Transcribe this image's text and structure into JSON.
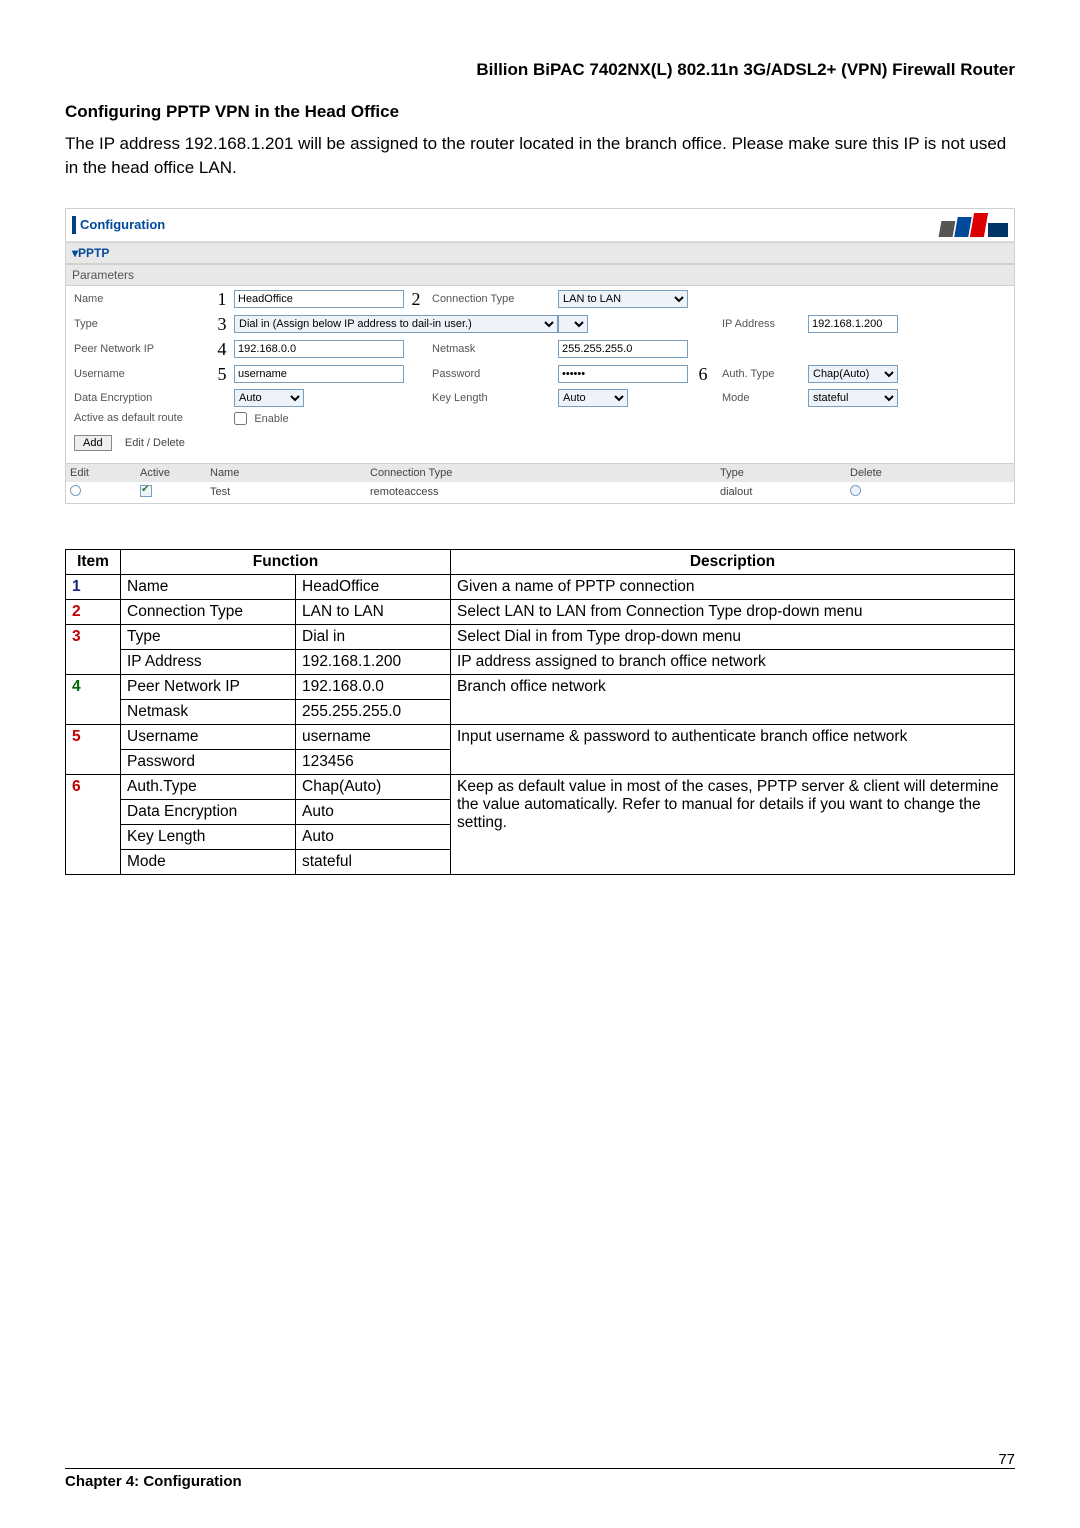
{
  "header": {
    "title": "Billion BiPAC 7402NX(L) 802.11n 3G/ADSL2+ (VPN) Firewall Router"
  },
  "section": {
    "heading": "Configuring PPTP VPN in the Head Office",
    "intro": "The IP address 192.168.1.201 will be assigned to the router located in the branch office. Please make sure this IP is not used in the head office LAN."
  },
  "config": {
    "title": "Configuration",
    "pptp_label": "▾PPTP",
    "parameters_label": "Parameters",
    "labels": {
      "name": "Name",
      "conn_type": "Connection Type",
      "type": "Type",
      "ip_address": "IP Address",
      "peer_ip": "Peer Network IP",
      "netmask": "Netmask",
      "username": "Username",
      "password": "Password",
      "auth_type": "Auth. Type",
      "data_enc": "Data Encryption",
      "key_len": "Key Length",
      "mode": "Mode",
      "default_route": "Active as default route",
      "enable": "Enable",
      "add": "Add",
      "edit_delete": "Edit / Delete"
    },
    "nums": {
      "n1": "1",
      "n2": "2",
      "n3": "3",
      "n4": "4",
      "n5": "5",
      "n6": "6"
    },
    "values": {
      "name": "HeadOffice",
      "conn_type": "LAN to LAN",
      "type_sel": "Dial in (Assign below IP address to dail-in user.)",
      "ip_address": "192.168.1.200",
      "peer_ip": "192.168.0.0",
      "netmask": "255.255.255.0",
      "username": "username",
      "password": "••••••",
      "auth_type": "Chap(Auto)",
      "data_enc": "Auto",
      "key_len": "Auto",
      "mode": "stateful"
    },
    "table": {
      "headers": {
        "edit": "Edit",
        "active": "Active",
        "name": "Name",
        "conn_type": "Connection Type",
        "type": "Type",
        "delete": "Delete"
      },
      "row": {
        "name": "Test",
        "conn_type": "remoteaccess",
        "type": "dialout"
      }
    }
  },
  "desc_table": {
    "headers": {
      "item": "Item",
      "function": "Function",
      "description": "Description"
    },
    "r1": {
      "num": "1",
      "f": "Name",
      "v": "HeadOffice",
      "d": "Given a name of PPTP connection"
    },
    "r2": {
      "num": "2",
      "f": "Connection Type",
      "v": "LAN to LAN",
      "d": "Select LAN to LAN from Connection Type drop-down menu"
    },
    "r3a": {
      "num": "3",
      "f": "Type",
      "v": "Dial in",
      "d": "Select Dial in from Type drop-down menu"
    },
    "r3b": {
      "f": "IP Address",
      "v": "192.168.1.200",
      "d": "IP address assigned to branch office network"
    },
    "r4a": {
      "num": "4",
      "f": "Peer Network IP",
      "v": "192.168.0.0",
      "d": "Branch office network"
    },
    "r4b": {
      "f": "Netmask",
      "v": "255.255.255.0"
    },
    "r5a": {
      "num": "5",
      "f": "Username",
      "v": "username",
      "d": "Input username & password to authenticate branch office network"
    },
    "r5b": {
      "f": "Password",
      "v": "123456"
    },
    "r6a": {
      "num": "6",
      "f": "Auth.Type",
      "v": "Chap(Auto)",
      "d": "Keep as default value in most of the cases, PPTP server & client will determine the value automatically. Refer to manual for details if you want to change the setting."
    },
    "r6b": {
      "f": "Data Encryption",
      "v": "Auto"
    },
    "r6c": {
      "f": "Key Length",
      "v": "Auto"
    },
    "r6d": {
      "f": "Mode",
      "v": "stateful"
    }
  },
  "footer": {
    "chapter": "Chapter 4: Configuration",
    "page": "77"
  }
}
